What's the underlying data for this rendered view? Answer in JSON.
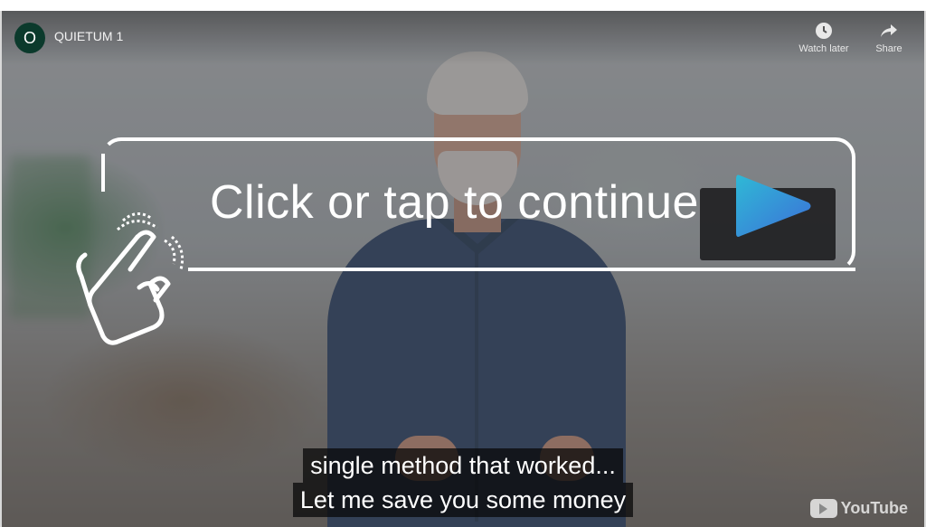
{
  "player": {
    "channel_initial": "O",
    "channel_name": "QUIETUM 1",
    "watch_later_label": "Watch later",
    "share_label": "Share",
    "watermark": "YouTube"
  },
  "overlay": {
    "cta_text": "Click or tap to continue",
    "play_colors": [
      "#2fb9d6",
      "#3c6fd8"
    ]
  },
  "captions": {
    "lines": [
      "single method that worked...",
      "Let me save you some money"
    ]
  },
  "icons": {
    "watch_later": "clock-icon",
    "share": "share-arrow-icon",
    "hand": "tap-hand-icon",
    "play": "play-triangle-icon"
  }
}
